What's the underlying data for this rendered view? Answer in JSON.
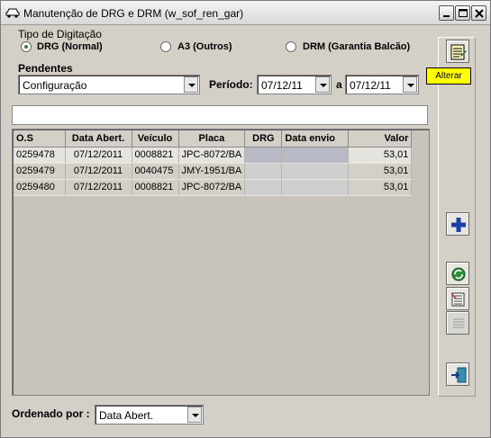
{
  "window": {
    "title": "Manutenção de DRG e DRM (w_sof_ren_gar)"
  },
  "tipo": {
    "label": "Tipo de Digitação",
    "options": [
      {
        "label": "DRG (Normal)",
        "selected": true
      },
      {
        "label": "A3 (Outros)",
        "selected": false
      },
      {
        "label": "DRM (Garantia Balcão)",
        "selected": false
      }
    ]
  },
  "pendentes": {
    "label": "Pendentes",
    "value": "Configuração"
  },
  "periodo": {
    "label": "Período:",
    "from": "07/12/11",
    "separator": "a",
    "to": "07/12/11"
  },
  "grid": {
    "columns": [
      "O.S",
      "Data Abert.",
      "Veículo",
      "Placa",
      "DRG",
      "Data envio",
      "Valor"
    ],
    "rows": [
      [
        "0259478",
        "07/12/2011",
        "0008821",
        "JPC-8072/BA",
        "",
        "",
        "53,01"
      ],
      [
        "0259479",
        "07/12/2011",
        "0040475",
        "JMY-1951/BA",
        "",
        "",
        "53,01"
      ],
      [
        "0259480",
        "07/12/2011",
        "0008821",
        "JPC-8072/BA",
        "",
        "",
        "53,01"
      ]
    ]
  },
  "toolbar": {
    "tooltip": "Alterar"
  },
  "ordenado": {
    "label": "Ordenado por :",
    "value": "Data Abert."
  }
}
